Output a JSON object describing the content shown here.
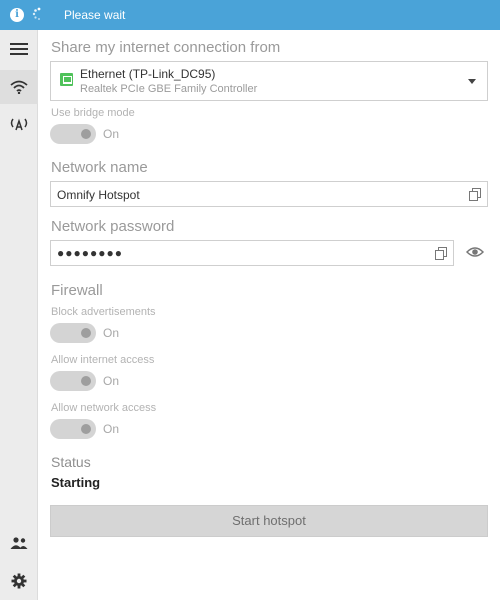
{
  "titlebar": {
    "status_text": "Please wait"
  },
  "share": {
    "title": "Share my internet connection from",
    "selected_name": "Ethernet (TP-Link_DC95)",
    "selected_adapter": "Realtek PCIe GBE Family Controller",
    "bridge_label": "Use bridge mode",
    "bridge_state": "On"
  },
  "network_name": {
    "title": "Network name",
    "value": "Omnify Hotspot"
  },
  "network_password": {
    "title": "Network password",
    "value": "●●●●●●●●"
  },
  "firewall": {
    "title": "Firewall",
    "items": [
      {
        "label": "Block advertisements",
        "state": "On"
      },
      {
        "label": "Allow internet access",
        "state": "On"
      },
      {
        "label": "Allow network access",
        "state": "On"
      }
    ]
  },
  "status": {
    "title": "Status",
    "value": "Starting"
  },
  "actions": {
    "start_label": "Start hotspot"
  },
  "icons": {
    "titlebar": [
      "info-icon",
      "spinner-icon"
    ],
    "sidebar": [
      "menu-icon",
      "wifi-icon",
      "antenna-icon",
      "users-icon",
      "settings-icon"
    ],
    "fields": [
      "ethernet-icon",
      "dropdown-caret-icon",
      "copy-icon",
      "eye-icon"
    ]
  },
  "colors": {
    "accent": "#4aa3d8",
    "ethernet": "#4fc25a",
    "sidebar_bg": "#ececec"
  }
}
